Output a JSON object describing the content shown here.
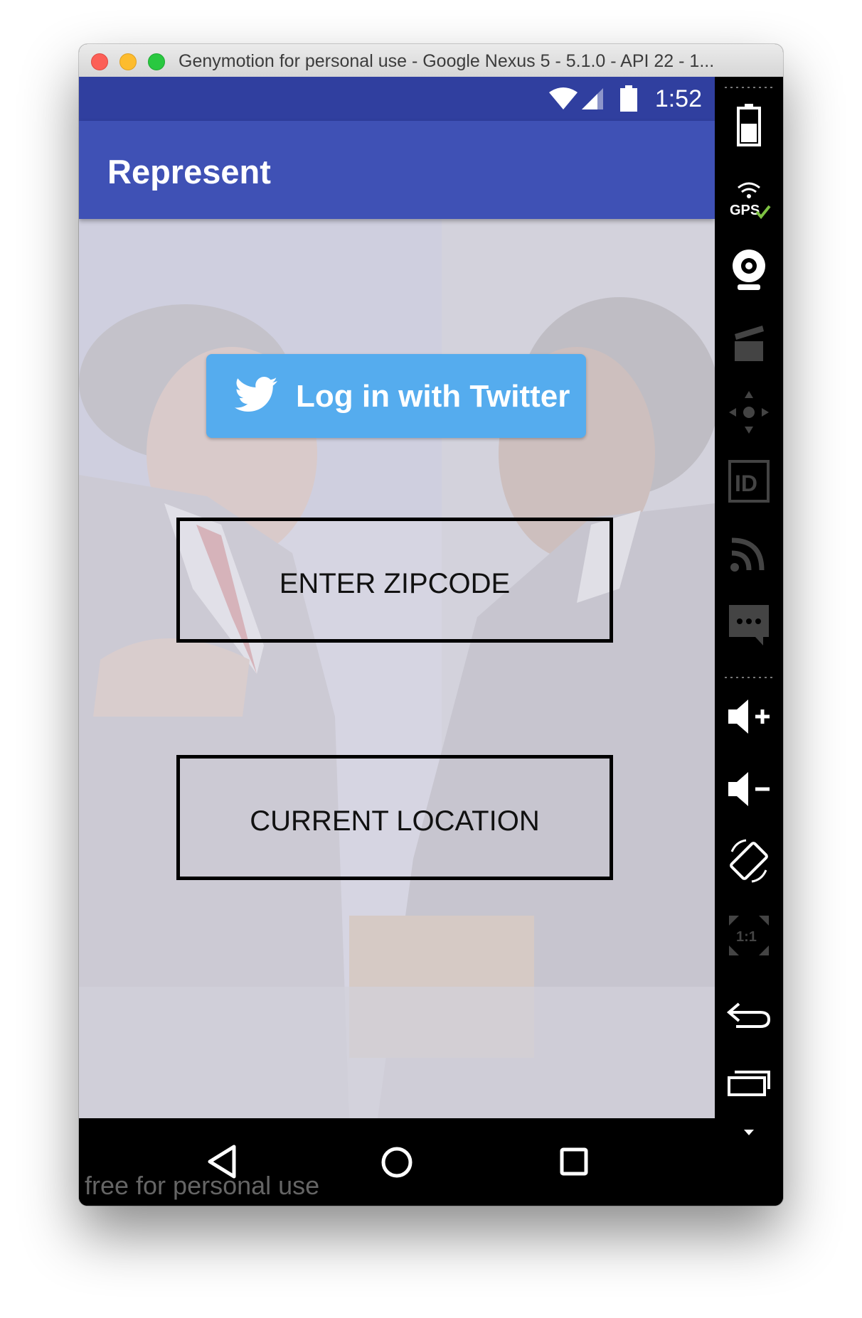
{
  "window": {
    "title": "Genymotion for personal use - Google Nexus 5 - 5.1.0 - API 22 - 1..."
  },
  "statusbar": {
    "time": "1:52",
    "icons": [
      "wifi-icon",
      "signal-icon",
      "battery-icon"
    ]
  },
  "appbar": {
    "title": "Represent"
  },
  "main": {
    "twitter_button": "Log in with Twitter",
    "zipcode_button": "ENTER ZIPCODE",
    "location_button": "CURRENT LOCATION"
  },
  "navbar": {
    "watermark": "free for personal use",
    "icons": [
      "back-icon",
      "home-icon",
      "recents-icon"
    ]
  },
  "toolbar": {
    "gps_label": "GPS",
    "id_label": "ID",
    "scale_label": "1:1",
    "icons": [
      "battery-icon",
      "gps-icon",
      "webcam-icon",
      "capture-icon",
      "dpad-icon",
      "identifiers-icon",
      "cast-icon",
      "sms-icon",
      "volume-up-icon",
      "volume-down-icon",
      "rotate-icon",
      "pixel-perfect-icon",
      "back-icon",
      "recent-apps-icon",
      "expand-icon"
    ]
  },
  "colors": {
    "statusbar": "#303f9f",
    "appbar": "#3f51b5",
    "twitter": "#55acee"
  }
}
